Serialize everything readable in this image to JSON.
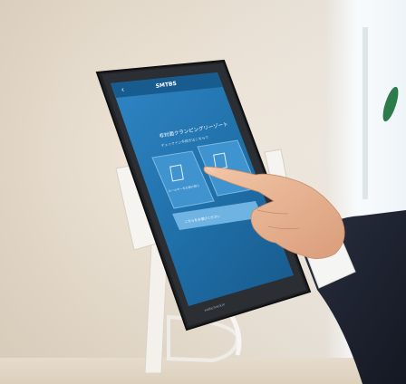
{
  "tablet": {
    "brand": "SMTBS",
    "title": "非対面クランピングリーゾート",
    "subtitle": "チェックイン手続きはこちらで",
    "card_left": "ルームキーをお受け取り",
    "card_right": "",
    "bottom_button": "こちらをお選びください",
    "back_label": "‹",
    "footer_brand": "webcheckin"
  },
  "colors": {
    "wall": "#e9dccb",
    "screen": "#1f6fa8",
    "sleeve": "#1e2230"
  }
}
